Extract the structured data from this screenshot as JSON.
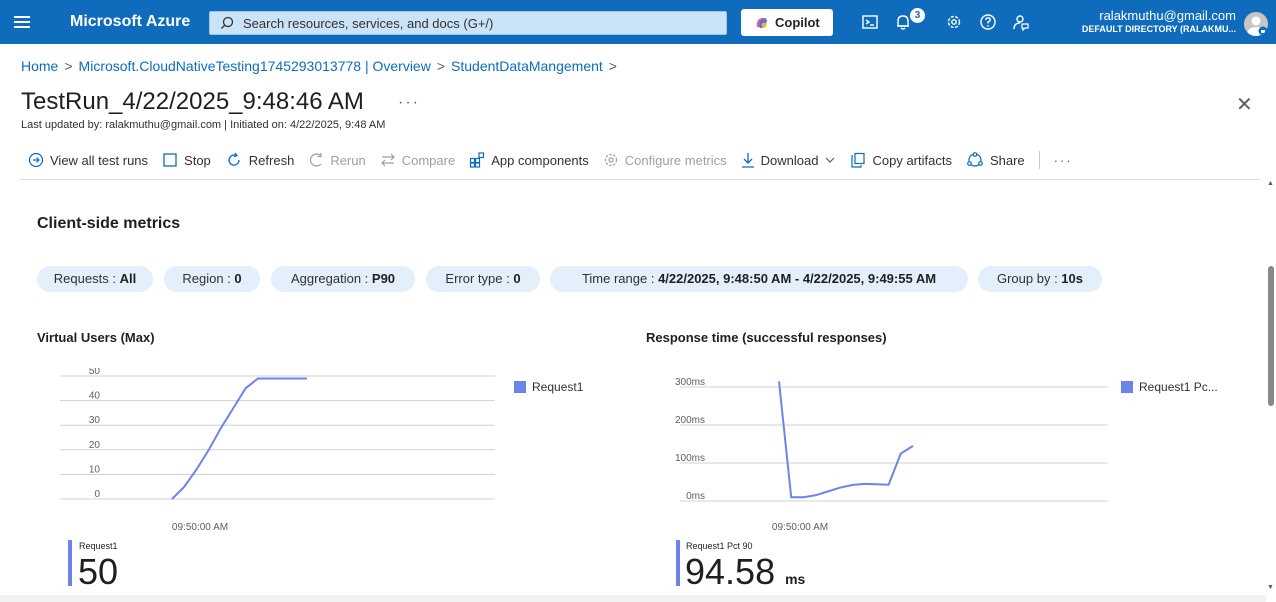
{
  "topbar": {
    "brand": "Microsoft Azure",
    "search_placeholder": "Search resources, services, and docs (G+/)",
    "copilot_label": "Copilot",
    "notifications_count": "3",
    "user_email": "ralakmuthu@gmail.com",
    "user_directory": "DEFAULT DIRECTORY (RALAKMU..."
  },
  "breadcrumb": [
    "Home",
    "Microsoft.CloudNativeTesting1745293013778 | Overview",
    "StudentDataMangement"
  ],
  "page": {
    "title": "TestRun_4/22/2025_9:48:46 AM",
    "subtitle": "Last updated by: ralakmuthu@gmail.com | Initiated on: 4/22/2025, 9:48 AM"
  },
  "commands": [
    {
      "label": "View all test runs",
      "icon": "arrow-right-circle-icon",
      "disabled": false
    },
    {
      "label": "Stop",
      "icon": "stop-icon",
      "disabled": false
    },
    {
      "label": "Refresh",
      "icon": "refresh-icon",
      "disabled": false
    },
    {
      "label": "Rerun",
      "icon": "rerun-icon",
      "disabled": true
    },
    {
      "label": "Compare",
      "icon": "compare-icon",
      "disabled": true
    },
    {
      "label": "App components",
      "icon": "app-components-icon",
      "disabled": false
    },
    {
      "label": "Configure metrics",
      "icon": "gear-icon",
      "disabled": true
    },
    {
      "label": "Download",
      "icon": "download-icon",
      "disabled": false
    },
    {
      "label": "Copy artifacts",
      "icon": "copy-icon",
      "disabled": false
    },
    {
      "label": "Share",
      "icon": "share-icon",
      "disabled": false
    }
  ],
  "section": {
    "title": "Client-side metrics",
    "filters": [
      {
        "key": "Requests : ",
        "value": "All"
      },
      {
        "key": "Region : ",
        "value": "0"
      },
      {
        "key": "Aggregation : ",
        "value": "P90"
      },
      {
        "key": "Error type : ",
        "value": "0"
      },
      {
        "key": "Time range : ",
        "value": "4/22/2025, 9:48:50 AM - 4/22/2025, 9:49:55 AM"
      },
      {
        "key": "Group by : ",
        "value": "10s"
      }
    ]
  },
  "colors": {
    "topbar": "#0f6cbd",
    "series": "#6c84e8",
    "pill": "#e3effa"
  },
  "chart_data": [
    {
      "type": "line",
      "title": "Virtual Users (Max)",
      "x_tick_label": "09:50:00 AM",
      "y_ticks": [
        "0",
        "10",
        "20",
        "30",
        "40",
        "50"
      ],
      "ylim": [
        0,
        50
      ],
      "legend": "Request1",
      "legend_position": "right",
      "grid": true,
      "series": [
        {
          "name": "Request1",
          "values": [
            0,
            5,
            12,
            20,
            29,
            37,
            45,
            49,
            49,
            49,
            49,
            49
          ]
        }
      ],
      "summary_label": "Request1",
      "summary_value": "50",
      "summary_unit": ""
    },
    {
      "type": "line",
      "title": "Response time (successful responses)",
      "x_tick_label": "09:50:00 AM",
      "y_ticks": [
        "0ms",
        "100ms",
        "200ms",
        "300ms"
      ],
      "ylim": [
        0,
        350
      ],
      "legend": "Request1 Pc...",
      "legend_position": "right",
      "grid": true,
      "series": [
        {
          "name": "Request1 Pc...",
          "values": [
            315,
            10,
            10,
            15,
            25,
            35,
            42,
            45,
            44,
            43,
            125,
            145
          ]
        }
      ],
      "summary_label": "Request1 Pct 90",
      "summary_value": "94.58",
      "summary_unit": "ms"
    }
  ]
}
